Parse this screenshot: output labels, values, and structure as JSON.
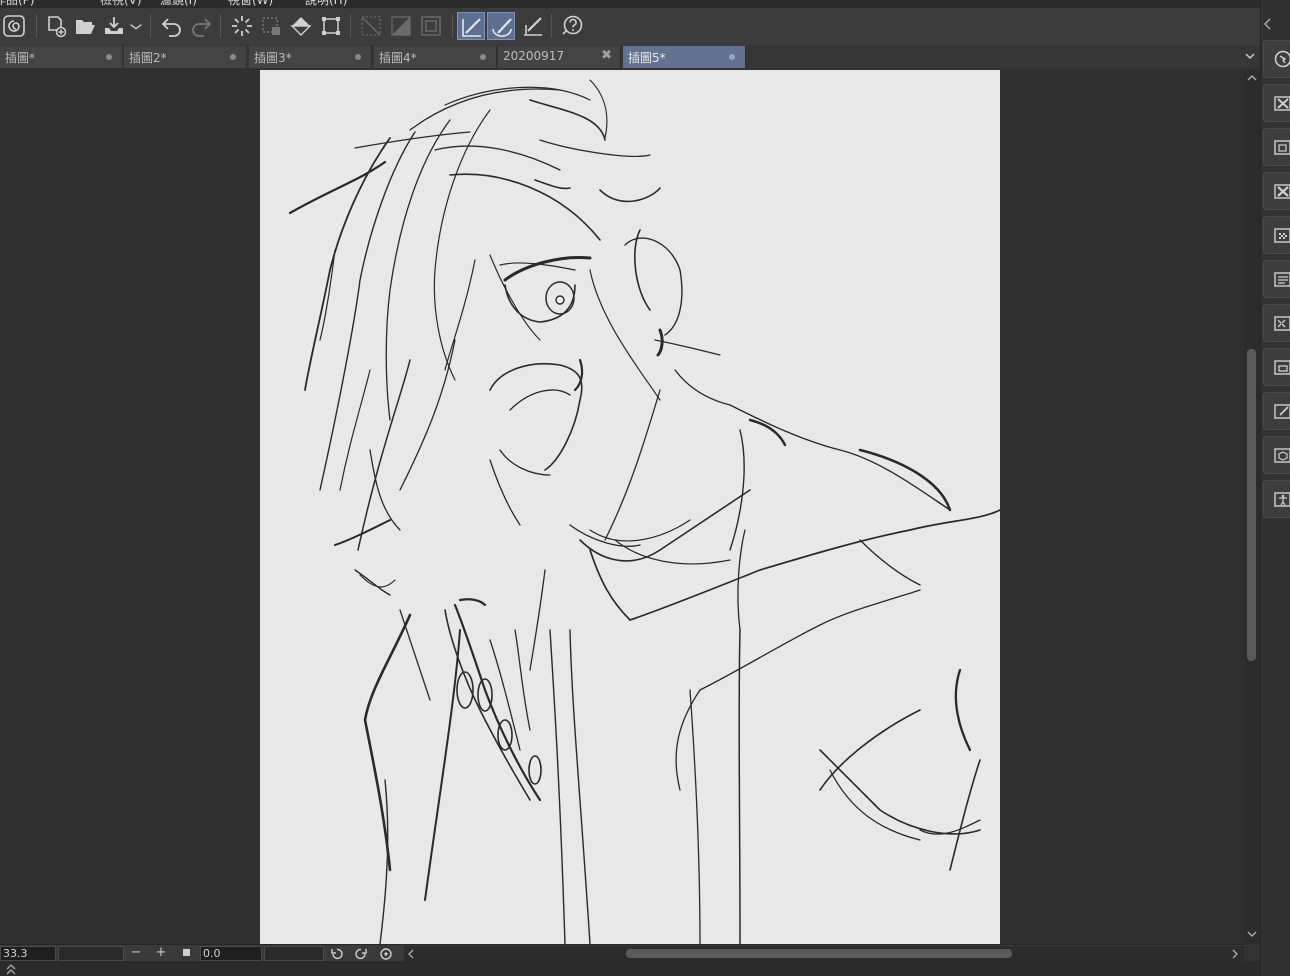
{
  "menubar": {
    "items": [
      "作品(P)",
      "檢視(V)",
      "濾鏡(I)",
      "視窗(W)",
      "說明(H)"
    ]
  },
  "toolbar": {
    "buttons": [
      {
        "name": "app-logo-button",
        "icon": "swirl-icon"
      },
      {
        "name": "new-file-button",
        "icon": "new-file-icon"
      },
      {
        "name": "open-file-button",
        "icon": "folder-open-icon"
      },
      {
        "name": "save-button",
        "icon": "save-icon"
      },
      {
        "name": "save-options-dropdown",
        "icon": "chevron-down-icon"
      },
      {
        "name": "undo-button",
        "icon": "undo-icon"
      },
      {
        "name": "redo-button",
        "icon": "redo-icon"
      },
      {
        "name": "loading-button",
        "icon": "spinner-icon"
      },
      {
        "name": "clear-selection-button",
        "icon": "selection-icon"
      },
      {
        "name": "fill-button",
        "icon": "fill-icon"
      },
      {
        "name": "transform-button",
        "icon": "transform-icon"
      },
      {
        "name": "ruler-button",
        "icon": "ruler-icon"
      },
      {
        "name": "gradient-button",
        "icon": "gradient-icon"
      },
      {
        "name": "frame-button",
        "icon": "frame-icon"
      },
      {
        "name": "snap-to-ruler-button",
        "icon": "snap-ruler-icon"
      },
      {
        "name": "snap-to-special-ruler-button",
        "icon": "snap-curve-icon"
      },
      {
        "name": "snap-to-grid-button",
        "icon": "snap-grid-icon"
      },
      {
        "name": "help-button",
        "icon": "help-icon"
      }
    ]
  },
  "tabs": [
    {
      "label": "插圖*",
      "state": "modified"
    },
    {
      "label": "插圖2*",
      "state": "modified"
    },
    {
      "label": "插圖3*",
      "state": "modified"
    },
    {
      "label": "插圖4*",
      "state": "modified"
    },
    {
      "label": "20200917",
      "state": "close"
    },
    {
      "label": "插圖5*",
      "state": "active"
    }
  ],
  "statusbar": {
    "zoom": "33.3",
    "rotation": "0.0",
    "zoom_out": "−",
    "zoom_in": "+"
  },
  "right_panel": {
    "buttons": [
      "navigator-icon",
      "layer-panel-icon",
      "material-icon",
      "close-panel-icon",
      "sub-view-icon",
      "layer-property-icon",
      "layer-search-icon",
      "history-icon",
      "auto-action-icon",
      "3d-object-icon",
      "accessibility-icon"
    ]
  },
  "colors": {
    "accent": "#627290",
    "canvas": "#e8e8e8",
    "bg": "#2f2f2f"
  }
}
